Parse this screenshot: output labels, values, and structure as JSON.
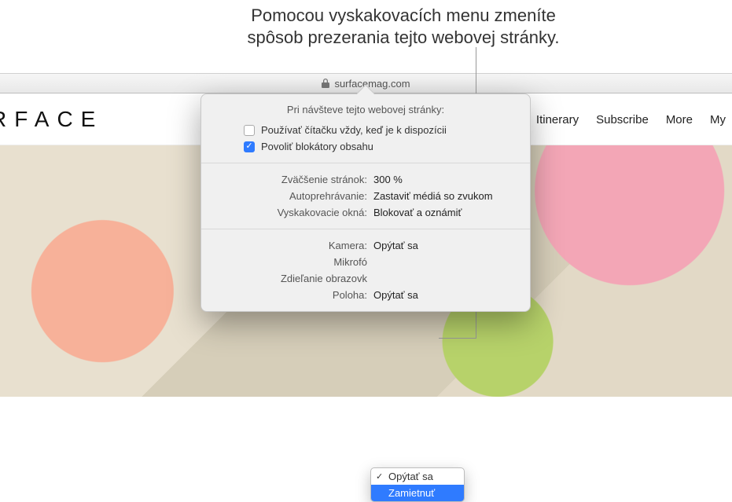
{
  "annotation": {
    "line1": "Pomocou vyskakovacích menu zmeníte",
    "line2": "spôsob prezerania tejto webovej stránky."
  },
  "browser": {
    "url_host": "surfacemag.com"
  },
  "page_header": {
    "logo_text": "RFACE",
    "nav": [
      "Itinerary",
      "Subscribe",
      "More",
      "My"
    ]
  },
  "popover": {
    "title": "Pri návšteve tejto webovej stránky:",
    "reader_label": "Používať čítačku vždy, keď je k dispozícii",
    "reader_checked": false,
    "content_blockers_label": "Povoliť blokátory obsahu",
    "content_blockers_checked": true,
    "rows_general": [
      {
        "label": "Zväčšenie stránok:",
        "value": "300 %"
      },
      {
        "label": "Autoprehrávanie:",
        "value": "Zastaviť médiá so zvukom"
      },
      {
        "label": "Vyskakovacie okná:",
        "value": "Blokovať a oznámiť"
      }
    ],
    "rows_privacy": [
      {
        "label": "Kamera:",
        "value": "Opýtať sa"
      },
      {
        "label": "Mikrofó",
        "value": ""
      },
      {
        "label": "Zdieľanie obrazovk",
        "value": ""
      },
      {
        "label": "Poloha:",
        "value": "Opýtať sa"
      }
    ]
  },
  "dropdown": {
    "items": [
      {
        "label": "Opýtať sa",
        "checked": true,
        "selected": false
      },
      {
        "label": "Zamietnuť",
        "checked": false,
        "selected": true
      }
    ]
  }
}
